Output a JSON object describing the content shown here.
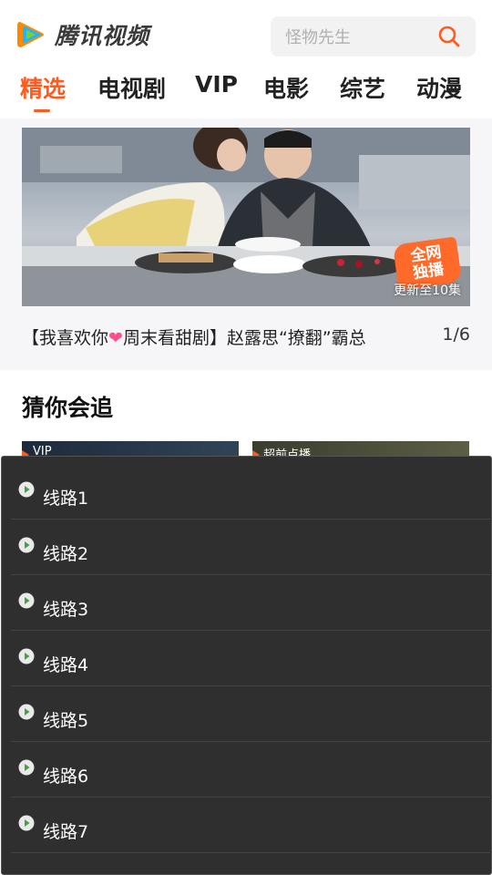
{
  "header": {
    "logo_text": "腾讯视频",
    "search_placeholder": "怪物先生"
  },
  "tabs": [
    {
      "label": "精选",
      "active": true
    },
    {
      "label": "电视剧",
      "active": false
    },
    {
      "label": "VIP",
      "active": false
    },
    {
      "label": "电影",
      "active": false
    },
    {
      "label": "综艺",
      "active": false
    },
    {
      "label": "动漫",
      "active": false
    }
  ],
  "banner": {
    "badge_line1": "全网",
    "badge_line2": "独播",
    "update_text": "更新至10集",
    "caption_part1": "【我喜欢你",
    "caption_part2": "周末看甜剧】赵露思“撩翻”霸总",
    "page_indicator": "1/6"
  },
  "section": {
    "title": "猜你会追",
    "cards": [
      {
        "tag": "VIP"
      },
      {
        "tag": "超前点播"
      }
    ]
  },
  "route_dialog": {
    "routes": [
      "线路1",
      "线路2",
      "线路3",
      "线路4",
      "线路5",
      "线路6",
      "线路7"
    ]
  },
  "colors": {
    "accent": "#ff5a1f",
    "dialog_bg": "#2f2f2f",
    "heart": "#ff4f8b"
  }
}
